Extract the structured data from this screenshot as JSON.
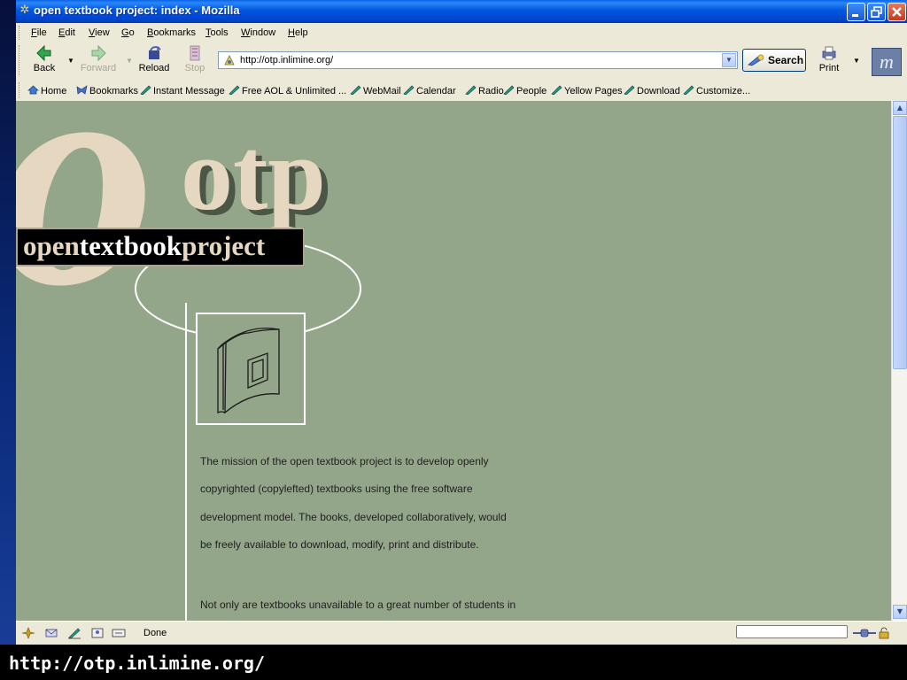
{
  "window": {
    "title": "open textbook project: index - Mozilla",
    "controls": [
      "minimize",
      "restore",
      "close"
    ]
  },
  "menubar": {
    "items": [
      {
        "key": "F",
        "rest": "ile"
      },
      {
        "key": "E",
        "rest": "dit"
      },
      {
        "key": "V",
        "rest": "iew"
      },
      {
        "key": "G",
        "rest": "o"
      },
      {
        "key": "B",
        "rest": "ookmarks"
      },
      {
        "key": "T",
        "rest": "ools"
      },
      {
        "key": "W",
        "rest": "indow"
      },
      {
        "key": "H",
        "rest": "elp"
      }
    ]
  },
  "navbar": {
    "back": "Back",
    "forward": "Forward",
    "reload": "Reload",
    "stop": "Stop",
    "url": "http://otp.inlimine.org/",
    "search": "Search",
    "print": "Print"
  },
  "personalbar": {
    "items": [
      "Home",
      "Bookmarks",
      "Instant Message",
      "Free AOL & Unlimited ...",
      "WebMail",
      "Calendar",
      "Radio",
      "People",
      "Yellow Pages",
      "Download",
      "Customize..."
    ]
  },
  "page": {
    "logo_letter": "o",
    "logo_word": "otp",
    "banner_parts": [
      "open",
      "textbook",
      "project"
    ],
    "mission_lines": [
      "The mission of the open textbook project is to develop openly",
      "copyrighted (copylefted) textbooks using the free software",
      "development model. The books, developed collaboratively, would",
      "be freely available to download, modify, print and distribute."
    ],
    "next_line": "Not only are textbooks unavailable to a great number of students in",
    "colors": {
      "background": "#94a68a",
      "logo_cream": "#e6d8c0",
      "logo_shadow": "#4c5646",
      "banner_bg": "#000000"
    }
  },
  "statusbar": {
    "text": "Done"
  },
  "caption": {
    "text": "http://otp.inlimine.org/"
  }
}
